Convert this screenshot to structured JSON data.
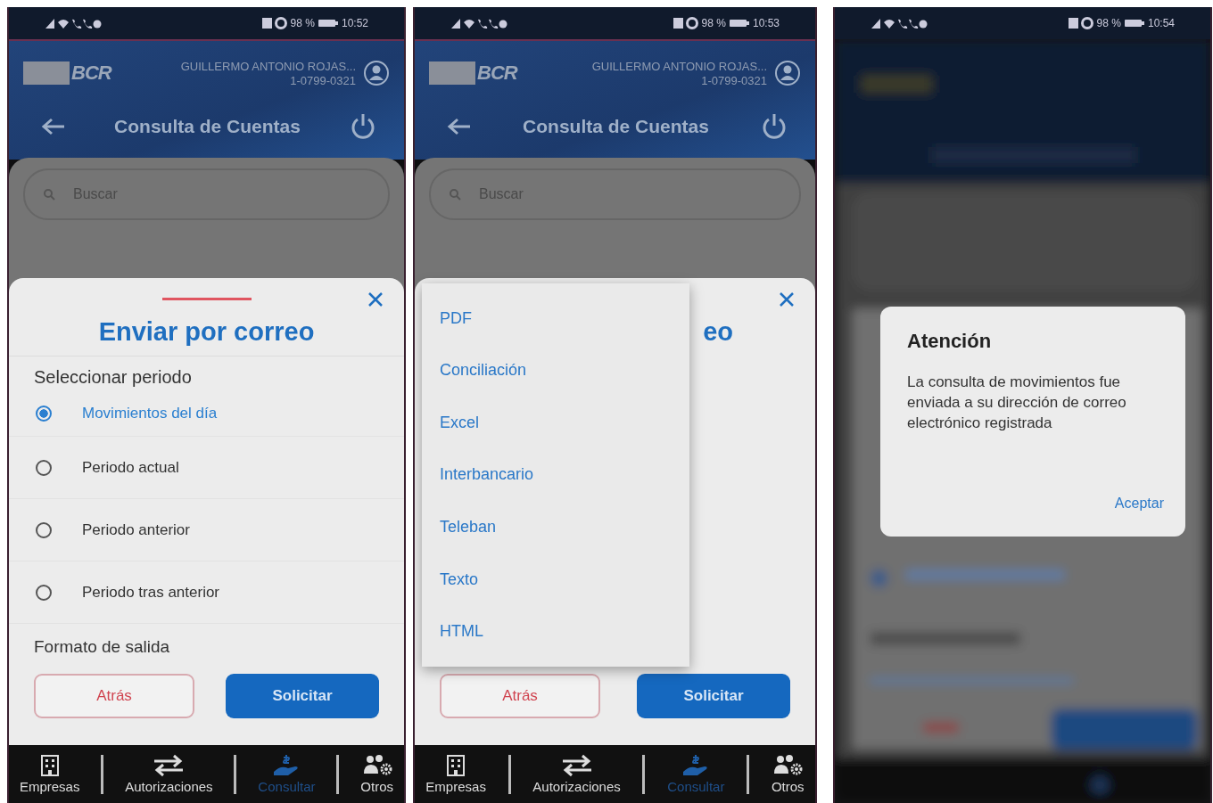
{
  "screens": [
    {
      "kind": "bottom_sheet",
      "status_bar": {
        "battery": "98 %",
        "time": "10:52"
      },
      "header": {
        "logo": "BCR",
        "user_name": "GUILLERMO ANTONIO ROJAS...",
        "user_id": "1-0799-0321",
        "title": "Consulta de Cuentas"
      },
      "search": {
        "placeholder": "Buscar"
      },
      "sheet": {
        "title": "Enviar por correo",
        "section": "Seleccionar periodo",
        "options": [
          {
            "label": "Movimientos del día",
            "selected": true
          },
          {
            "label": "Periodo actual",
            "selected": false
          },
          {
            "label": "Periodo anterior",
            "selected": false
          },
          {
            "label": "Periodo tras anterior",
            "selected": false
          }
        ],
        "format_label": "Formato de salida",
        "buttons": [
          {
            "label": "Atrás",
            "kind": "outline"
          },
          {
            "label": "Solicitar",
            "kind": "primary"
          }
        ]
      },
      "nav": [
        {
          "label": "Empresas",
          "selected": false
        },
        {
          "label": "Autorizaciones",
          "selected": false
        },
        {
          "label": "Consultar",
          "selected": true
        },
        {
          "label": "Otros",
          "selected": false
        }
      ]
    },
    {
      "kind": "dropdown",
      "status_bar": {
        "battery": "98 %",
        "time": "10:53"
      },
      "header": {
        "logo": "BCR",
        "user_name": "GUILLERMO ANTONIO ROJAS...",
        "user_id": "1-0799-0321",
        "title": "Consulta de Cuentas"
      },
      "search": {
        "placeholder": "Buscar"
      },
      "sheet": {
        "title_fragment": "eo",
        "menu": [
          "PDF",
          "Conciliación",
          "Excel",
          "Interbancario",
          "Teleban",
          "Texto",
          "HTML"
        ],
        "buttons": [
          {
            "label": "Atrás",
            "kind": "outline"
          },
          {
            "label": "Solicitar",
            "kind": "primary"
          }
        ]
      },
      "nav": [
        {
          "label": "Empresas",
          "selected": false
        },
        {
          "label": "Autorizaciones",
          "selected": false
        },
        {
          "label": "Consultar",
          "selected": true
        },
        {
          "label": "Otros",
          "selected": false
        }
      ]
    },
    {
      "kind": "dialog",
      "status_bar": {
        "battery": "98 %",
        "time": "10:54"
      },
      "dialog": {
        "title": "Atención",
        "message": "La consulta de movimientos fue enviada a su dirección de correo electrónico registrada",
        "action": "Aceptar"
      }
    }
  ]
}
